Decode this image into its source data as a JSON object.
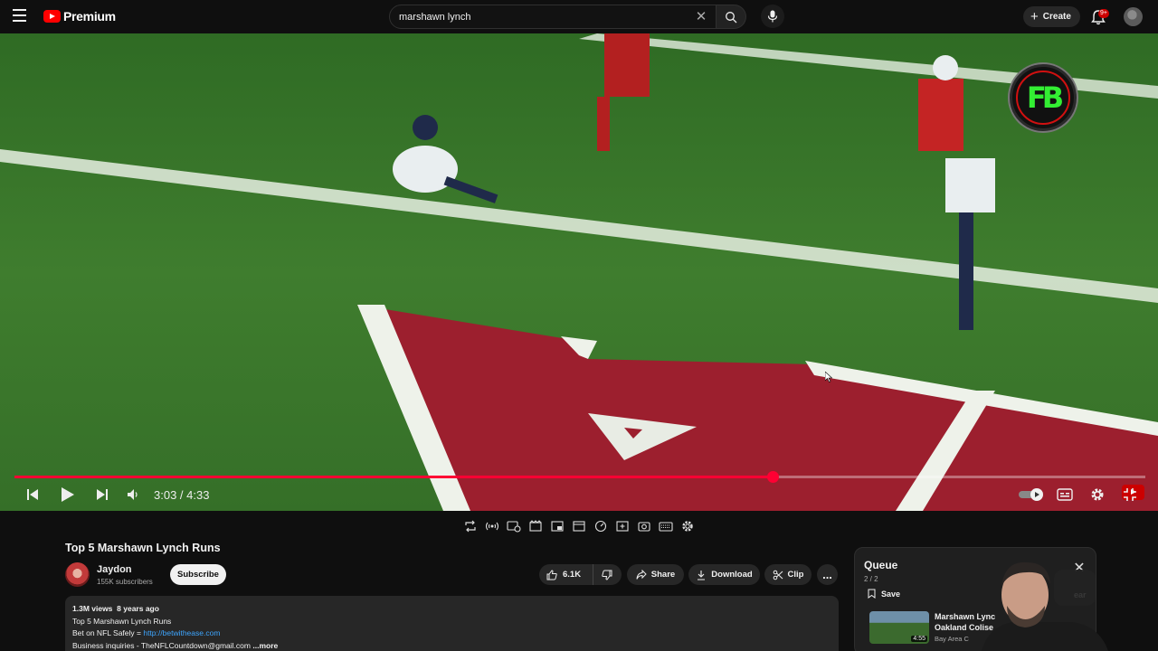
{
  "header": {
    "brand": "Premium",
    "search": {
      "value": "marshawn lynch",
      "placeholder": "Search"
    },
    "create_label": "Create",
    "notification_count": "9+"
  },
  "player": {
    "current_time": "3:03",
    "duration": "4:33",
    "time_display": "3:03 / 4:33",
    "progress_fraction": 0.67,
    "overlay_logo_text": "FB"
  },
  "video": {
    "title": "Top 5 Marshawn Lynch Runs",
    "channel": {
      "name": "Jaydon",
      "subscribers": "155K subscribers"
    },
    "subscribe_label": "Subscribe",
    "likes": "6.1K",
    "share_label": "Share",
    "download_label": "Download",
    "clip_label": "Clip",
    "more_label": "...",
    "description": {
      "views": "1.3M views",
      "age": "8 years ago",
      "line1": "Top 5 Marshawn Lynch Runs",
      "line2_prefix": "Bet on NFL Safely = ",
      "line2_link": "http://betwithease.com",
      "line3": "Business inquiries - TheNFLCountdown@gmail.com",
      "more": "...more"
    }
  },
  "queue": {
    "title": "Queue",
    "count": "2 / 2",
    "save_label": "Save",
    "clear_label": "ear",
    "items": [
      {
        "title_line1": "Marshawn Lync",
        "title_line2": "Oakland Colise",
        "channel": "Bay Area C",
        "duration": "4:55"
      }
    ]
  },
  "colors": {
    "accent": "#ff0033",
    "background": "#0f0f0f",
    "surface": "#272727",
    "link": "#3ea6ff"
  },
  "icons": {
    "menu": "hamburger-icon",
    "search": "search-icon",
    "clear": "close-icon",
    "mic": "microphone-icon",
    "bell": "bell-icon"
  }
}
